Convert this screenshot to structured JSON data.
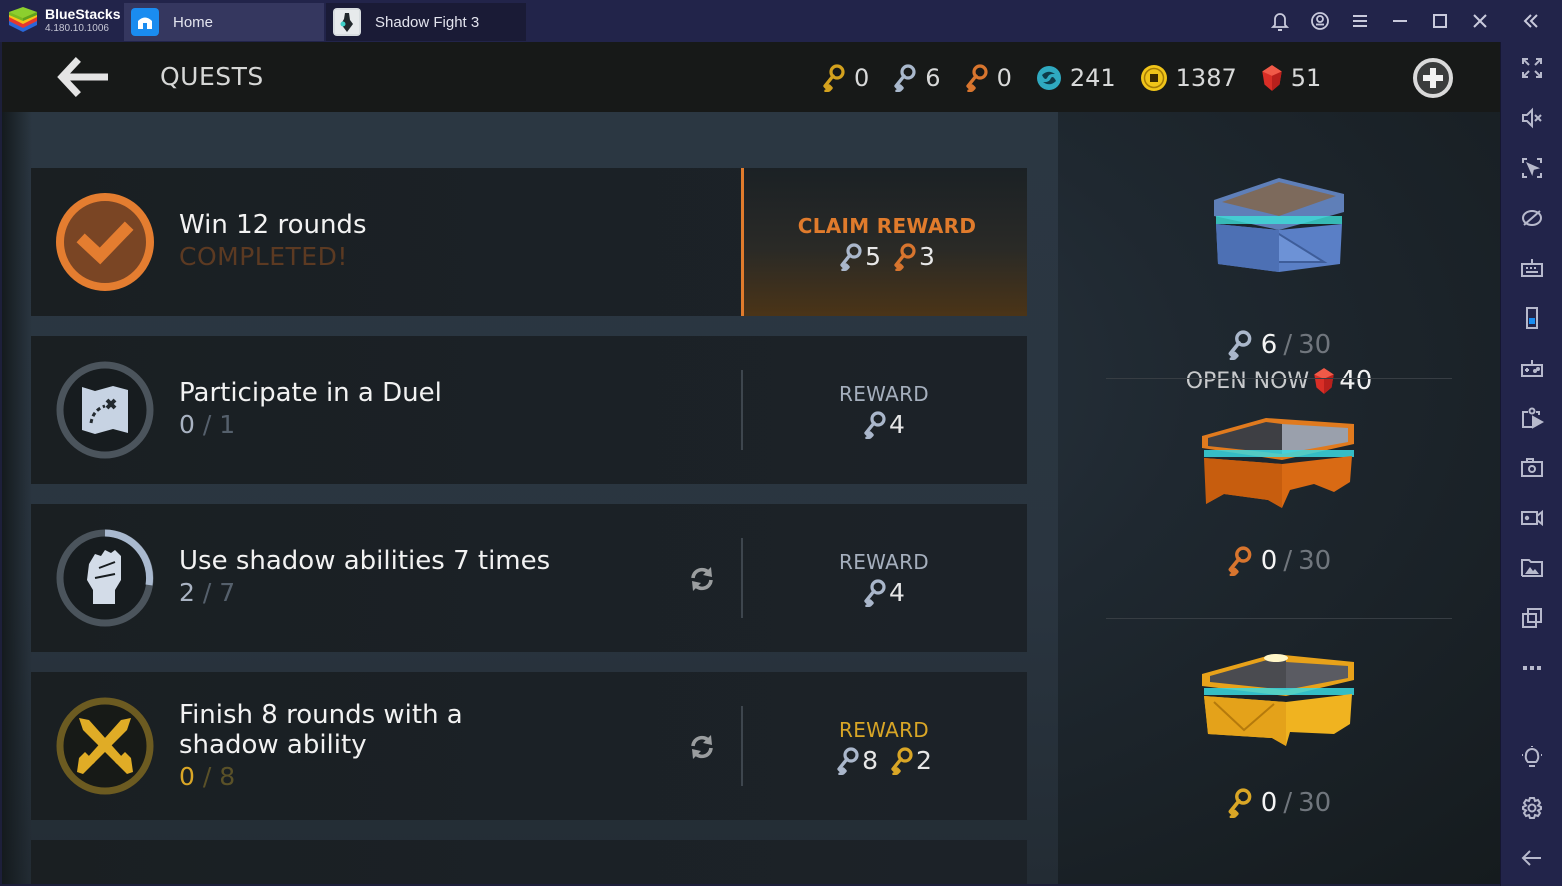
{
  "window": {
    "app_name": "BlueStacks",
    "app_version": "4.180.10.1006",
    "tabs": [
      {
        "label": "Home",
        "icon": "home-icon",
        "active": false
      },
      {
        "label": "Shadow Fight 3",
        "icon": "game-thumbnail",
        "active": true
      }
    ],
    "controls": [
      "bell-icon",
      "account-icon",
      "menu-icon",
      "minimize-icon",
      "maximize-icon",
      "close-icon",
      "collapse-sidebar-icon"
    ]
  },
  "sidebar": {
    "items": [
      {
        "icon": "fullscreen-icon",
        "label": "Full screen"
      },
      {
        "icon": "mute-icon",
        "label": "Volume"
      },
      {
        "icon": "lock-cursor-icon",
        "label": "Lock cursor"
      },
      {
        "icon": "hide-icon",
        "label": "Eco mode"
      },
      {
        "icon": "keyboard-icon",
        "label": "Keyboard controls"
      },
      {
        "icon": "device-rotate-icon",
        "label": "Rotate"
      },
      {
        "icon": "gamepad-icon",
        "label": "Game controls"
      },
      {
        "icon": "install-apk-icon",
        "label": "Install APK"
      },
      {
        "icon": "camera-icon",
        "label": "Screenshot"
      },
      {
        "icon": "record-icon",
        "label": "Record"
      },
      {
        "icon": "media-folder-icon",
        "label": "Media folder"
      },
      {
        "icon": "multi-instance-icon",
        "label": "Multi-instance"
      },
      {
        "icon": "more-icon",
        "label": "More"
      },
      {
        "icon": "lightbulb-icon",
        "label": "Tips"
      },
      {
        "icon": "settings-icon",
        "label": "Settings"
      },
      {
        "icon": "back-icon",
        "label": "Back"
      }
    ]
  },
  "game": {
    "title": "QUESTS",
    "currencies": [
      {
        "name": "gold-key",
        "value": "0",
        "color": "#d4a21e"
      },
      {
        "name": "silver-key",
        "value": "6",
        "color": "#a9b8cc"
      },
      {
        "name": "bronze-key",
        "value": "0",
        "color": "#d8752e"
      },
      {
        "name": "shadow-orb",
        "value": "241",
        "color": "#2fa9c0"
      },
      {
        "name": "coin",
        "value": "1387",
        "color": "#f0c419"
      },
      {
        "name": "gem",
        "value": "51",
        "color": "#e0362c"
      }
    ],
    "quests": [
      {
        "title": "Win 12 rounds",
        "status": "COMPLETED!",
        "icon": "checkmark-icon",
        "completed": true,
        "reward_label": "CLAIM REWARD",
        "rewards": [
          {
            "key": "silver",
            "value": "5"
          },
          {
            "key": "bronze",
            "value": "3"
          }
        ]
      },
      {
        "title": "Participate in a Duel",
        "progress_current": "0",
        "progress_sep": "/",
        "progress_total": "1",
        "icon": "map-icon",
        "reward_label": "REWARD",
        "rewards": [
          {
            "key": "silver",
            "value": "4"
          }
        ]
      },
      {
        "title": "Use shadow abilities 7 times",
        "progress_current": "2",
        "progress_sep": "/",
        "progress_total": "7",
        "progress_fraction": 0.2857,
        "icon": "fist-icon",
        "refreshable": true,
        "reward_label": "REWARD",
        "rewards": [
          {
            "key": "silver",
            "value": "4"
          }
        ]
      },
      {
        "title_line1": "Finish 8 rounds with a",
        "title_line2": "shadow ability",
        "progress_current": "0",
        "progress_sep": "/",
        "progress_total": "8",
        "icon": "crossed-swords-icon",
        "refreshable": true,
        "reward_label": "REWARD",
        "rewards": [
          {
            "key": "silver",
            "value": "8"
          },
          {
            "key": "gold",
            "value": "2"
          }
        ]
      }
    ],
    "chests": [
      {
        "type": "silver",
        "current": "6",
        "sep": "/",
        "max": "30",
        "open_now_label": "OPEN NOW",
        "open_now_cost": "40"
      },
      {
        "type": "bronze",
        "current": "0",
        "sep": "/",
        "max": "30"
      },
      {
        "type": "gold",
        "current": "0",
        "sep": "/",
        "max": "30"
      }
    ]
  }
}
